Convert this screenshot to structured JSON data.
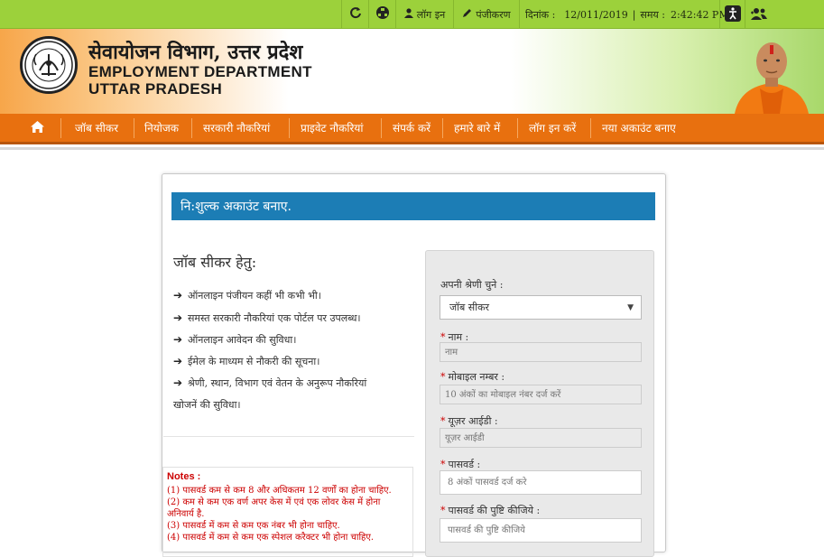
{
  "topbar": {
    "login_label": "लॉग इन",
    "register_label": "पंजीकरण",
    "date_label": "दिनांक :",
    "date_value": "12/011/2019",
    "time_label": "समय :",
    "time_value": "2:42:42 PM"
  },
  "header": {
    "title_hindi": "सेवायोजन विभाग, उत्तर प्रदेश",
    "title_en_line1": "EMPLOYMENT DEPARTMENT",
    "title_en_line2": "UTTAR PRADESH"
  },
  "nav": {
    "items": [
      "जॉब सीकर",
      "नियोजक",
      "सरकारी नौकरियां",
      "प्राइवेट नौकरियां",
      "संपर्क करें",
      "हमारे बारे में",
      "लॉग इन करें",
      "नया अकाउंट बनाए"
    ]
  },
  "card": {
    "title": "नि:शुल्क अकाउंट बनाए.",
    "left_heading": "जॉब सीकर हेतु:",
    "benefits": [
      "ऑनलाइन पंजीयन कहीं भी कभी भी।",
      "समस्त सरकारी नौकरियां एक पोर्टल पर उपलब्ध।",
      "ऑनलाइन आवेदन की सुविधा।",
      "ईमेल के माध्यम से नौकरी की सूचना।",
      "श्रेणी, स्थान, विभाग एवं वेतन के अनुरूप नौकरियां",
      "खोजनें की सुविधा।"
    ],
    "notes_heading": "Notes :",
    "notes": [
      "(1) पासवर्ड कम से कम 8 और अधिकतम 12 वर्णों का होना चाहिए.",
      "(2) कम से कम एक वर्ण अपर केस में एवं एक लोवर केस में होना",
      "अनिवार्य है.",
      "(3) पासवर्ड में कम से कम एक नंबर भी होना चाहिए.",
      "(4) पासवर्ड में कम से कम एक स्पेशल करैक्टर भी होना चाहिए."
    ]
  },
  "form": {
    "category_label": "अपनी श्रेणी चुने :",
    "category_value": "जॉब सीकर",
    "name_label": "नाम :",
    "name_placeholder": "नाम",
    "mobile_label": "मोबाइल नम्बर :",
    "mobile_placeholder": "10 अंकों का मोबाइल नंबर दर्ज करें",
    "userid_label": "यूज़र आईडी :",
    "userid_placeholder": "यूज़र आईडी",
    "password_label": "पासवर्ड :",
    "password_placeholder": "8 अंकों पासवर्ड दर्ज करे",
    "confirm_label": "पासवर्ड की पुष्टि कीजिये :",
    "confirm_placeholder": "पासवर्ड की पुष्टि कीजिये",
    "required_mark": "*"
  },
  "colors": {
    "topbar": "#9cd13b",
    "nav": "#e8700f",
    "title_bar": "#1c7db5",
    "notes_text": "#cc0000"
  },
  "icons": [
    "refresh-icon",
    "sitemap-icon",
    "user-icon",
    "pencil-icon",
    "accessibility-icon",
    "users-icon",
    "home-icon",
    "arrow-right-icon",
    "dropdown-caret-icon"
  ]
}
